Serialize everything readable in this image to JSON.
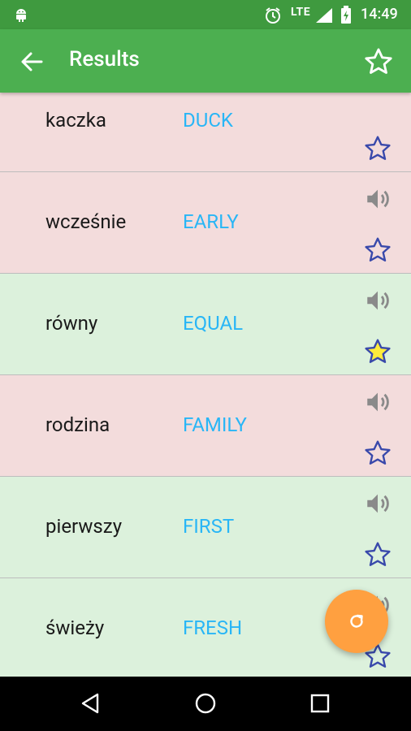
{
  "status_bar": {
    "network": "LTE",
    "time": "14:49",
    "icons": [
      "android-icon",
      "alarm-icon",
      "signal-icon",
      "battery-charging-icon"
    ]
  },
  "app_bar": {
    "title": "Results",
    "back_icon": "arrow-back-icon",
    "favorite_icon": "star-outline-icon"
  },
  "results": [
    {
      "polish": "kaczka",
      "english": "DUCK",
      "correct": false,
      "starred": false
    },
    {
      "polish": "wcześnie",
      "english": "EARLY",
      "correct": false,
      "starred": false
    },
    {
      "polish": "równy",
      "english": "EQUAL",
      "correct": true,
      "starred": true
    },
    {
      "polish": "rodzina",
      "english": "FAMILY",
      "correct": false,
      "starred": false
    },
    {
      "polish": "pierwszy",
      "english": "FIRST",
      "correct": true,
      "starred": false
    },
    {
      "polish": "świeży",
      "english": "FRESH",
      "correct": true,
      "starred": false
    }
  ],
  "fab": {
    "icon": "refresh-icon"
  },
  "nav_bar": {
    "icons": [
      "back-triangle-icon",
      "home-circle-icon",
      "recents-square-icon"
    ]
  },
  "colors": {
    "status_bar": "#3f9a3f",
    "app_bar": "#4caf50",
    "wrong_row": "#f3dcdc",
    "correct_row": "#dcf1dc",
    "english_text": "#29b6f6",
    "star_outline": "#3949ab",
    "star_fill": "#ffeb3b",
    "fab": "#ffa040"
  }
}
